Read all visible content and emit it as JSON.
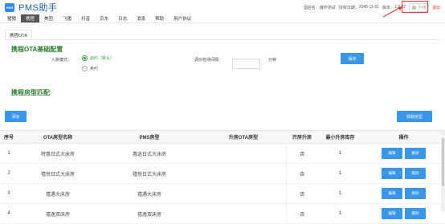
{
  "app": {
    "logo_text": "PMS",
    "title": "PMS助手"
  },
  "header": {
    "hotel_label": "酒店名：",
    "hotel_name": "爆炸测试",
    "expire_label": "授权日期：",
    "expire_date": "2045-11-01",
    "version_label": "版本：",
    "version": "1.0.42",
    "status_text": "下线",
    "logout_label": "退出"
  },
  "nav": {
    "items": [
      {
        "label": "猪猪",
        "active": false
      },
      {
        "label": "携程",
        "active": true
      },
      {
        "label": "美团",
        "active": false
      },
      {
        "label": "飞猪",
        "active": false
      },
      {
        "label": "抖音",
        "active": false
      },
      {
        "label": "京东",
        "active": false
      },
      {
        "label": "日志",
        "active": false
      },
      {
        "label": "消息",
        "active": false
      },
      {
        "label": "帮助",
        "active": false
      },
      {
        "label": "用户协议",
        "active": false
      }
    ]
  },
  "tabs": [
    {
      "label": "携程OTA"
    }
  ],
  "config": {
    "title": "携程OTA基础配置",
    "mode_label": "入账模式：",
    "mode_options": [
      {
        "label": "启约（默认）",
        "checked": true
      },
      {
        "label": "卖约",
        "checked": false
      }
    ],
    "interval_label": "调价检测间隔：",
    "interval_value": "",
    "interval_unit": "分钟",
    "save_label": "保存"
  },
  "mapping": {
    "title": "携程房型匹配",
    "add_label": "添加",
    "fetch_label": "获取房型"
  },
  "table": {
    "headers": [
      "序号",
      "OTA房型名称",
      "PMS房型",
      "升房OTA房型",
      "开房升房",
      "最小升房库存",
      "操作"
    ],
    "rows": [
      {
        "idx": "1",
        "ota": "特惠日式大床房",
        "pms": "惠选日式大床房",
        "upgrade_ota": "",
        "open_upgrade": "否",
        "min_stock": "1"
      },
      {
        "idx": "2",
        "ota": "禧悦日式大床房",
        "pms": "禧悦日式大床房",
        "upgrade_ota": "",
        "open_upgrade": "否",
        "min_stock": "1"
      },
      {
        "idx": "3",
        "ota": "禧遇大床房",
        "pms": "禧遇大床房",
        "upgrade_ota": "",
        "open_upgrade": "否",
        "min_stock": "1"
      },
      {
        "idx": "4",
        "ota": "禧逸双床房",
        "pms": "禧逸双床房",
        "upgrade_ota": "",
        "open_upgrade": "否",
        "min_stock": "1"
      }
    ],
    "edit_label": "编辑",
    "delete_label": "删除"
  },
  "colors": {
    "accent": "#3a96e8",
    "title_green": "#2e7d32",
    "highlight_red": "#e53935"
  }
}
